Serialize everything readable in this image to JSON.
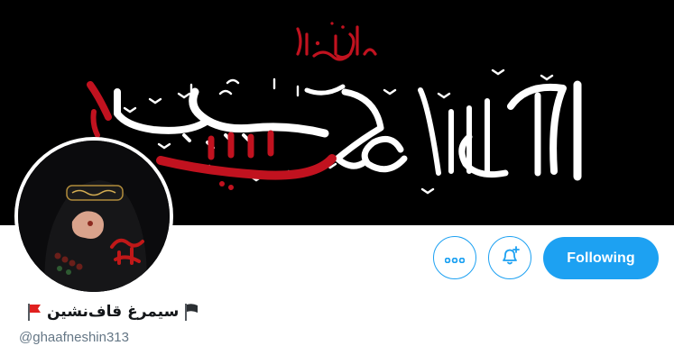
{
  "profile": {
    "display_name": "سیمرغ قاف‌نشین",
    "handle": "@ghaafneshin313",
    "flag_left_icon": "red-flag-icon",
    "flag_right_icon": "black-flag-icon"
  },
  "banner": {
    "calligraphy_small": "قال رسول الله",
    "calligraphy_main": "احب الله من احب حسينا",
    "background_color": "#000000",
    "accent_color": "#c1121f"
  },
  "actions": {
    "more_icon": "more-dots-icon",
    "notify_icon": "bell-plus-icon",
    "follow_label": "Following",
    "accent_color": "#1da1f2"
  }
}
